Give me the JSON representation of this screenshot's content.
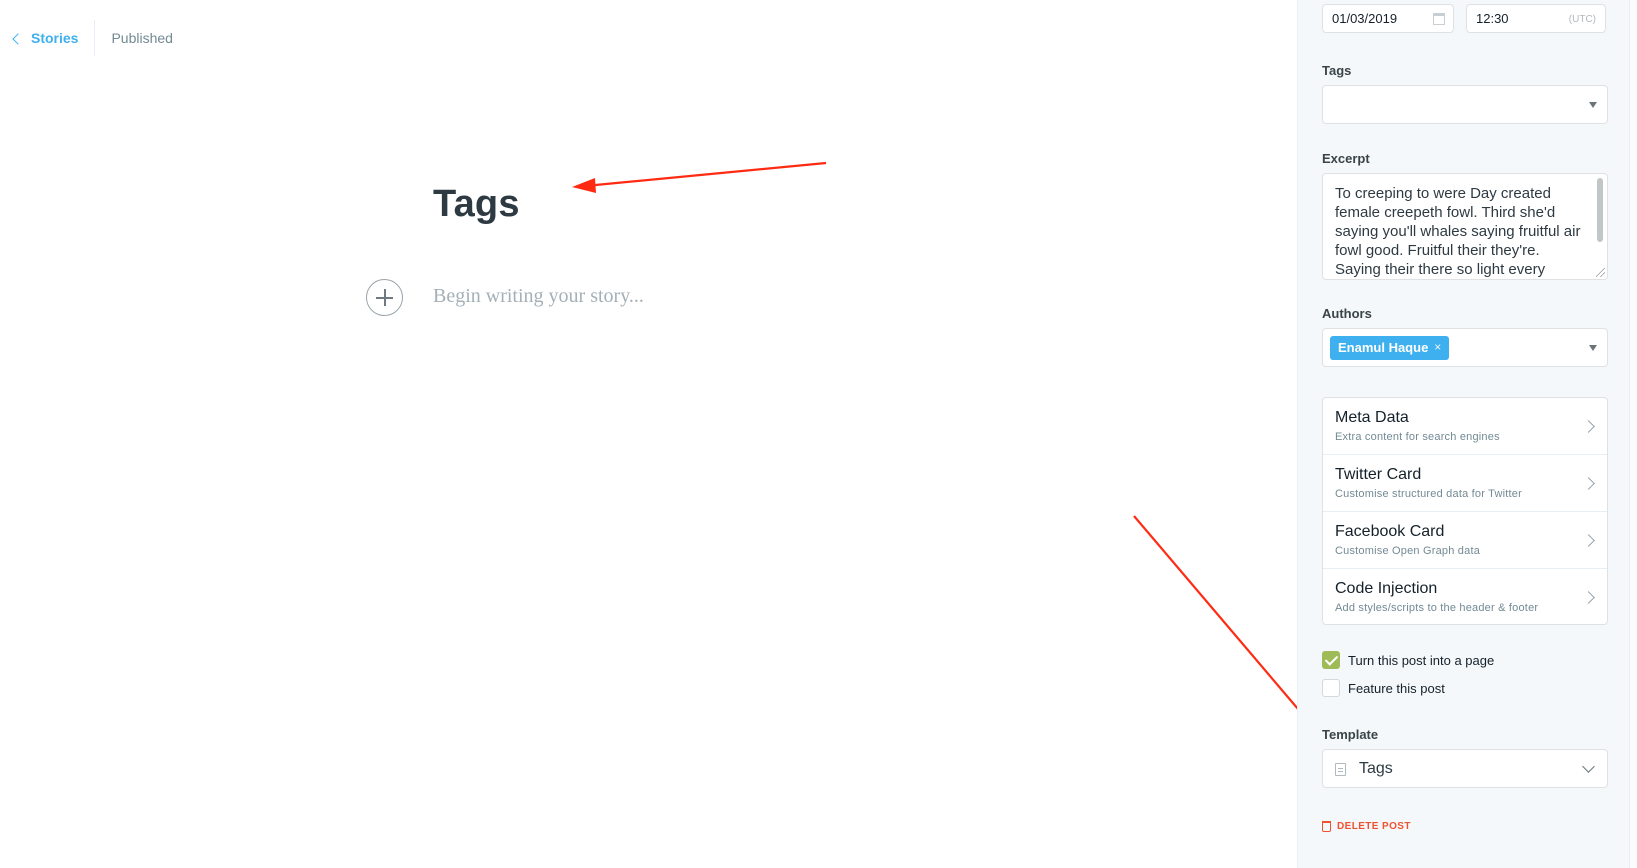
{
  "header": {
    "back_label": "Stories",
    "status": "Published"
  },
  "editor": {
    "title": "Tags",
    "body_placeholder": "Begin writing your story..."
  },
  "settings": {
    "publish_date": "01/03/2019",
    "publish_time": "12:30",
    "timezone": "(UTC)",
    "tags": {
      "label": "Tags",
      "value": ""
    },
    "excerpt": {
      "label": "Excerpt",
      "value": "To creeping to were Day created female creepeth fowl. Third she'd saying you'll whales saying fruitful air fowl good. Fruitful their they're. Saying their there so light every"
    },
    "authors": {
      "label": "Authors",
      "selected": [
        "Enamul Haque"
      ]
    },
    "menu_items": [
      {
        "title": "Meta Data",
        "description": "Extra content for search engines"
      },
      {
        "title": "Twitter Card",
        "description": "Customise structured data for Twitter"
      },
      {
        "title": "Facebook Card",
        "description": "Customise Open Graph data"
      },
      {
        "title": "Code Injection",
        "description": "Add styles/scripts to the header & footer"
      }
    ],
    "checkboxes": [
      {
        "label": "Turn this post into a page",
        "checked": true
      },
      {
        "label": "Feature this post",
        "checked": false
      }
    ],
    "template": {
      "label": "Template",
      "value": "Tags"
    },
    "delete_label": "DELETE POST"
  },
  "colors": {
    "accent_blue": "#3eb0ef",
    "checkbox_green": "#9fbb58",
    "delete_red": "#f05230",
    "annotation_red": "#ff2a12"
  },
  "icons": {
    "back": "chevron-left-icon",
    "add_card": "plus-icon",
    "date": "calendar-icon",
    "dropdown": "caret-down-icon",
    "menu": "chevron-right-icon",
    "template": "document-icon",
    "delete": "trash-icon"
  }
}
